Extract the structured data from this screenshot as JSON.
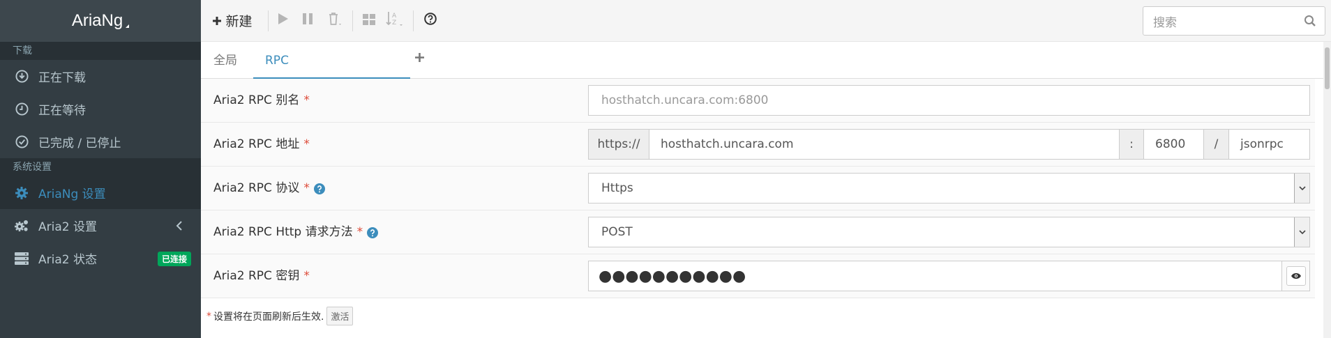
{
  "app": {
    "title": "AriaNg"
  },
  "sidebar": {
    "downloads_header": "下载",
    "downloads": [
      {
        "label": "正在下载",
        "icon": "download-icon"
      },
      {
        "label": "正在等待",
        "icon": "clock-icon"
      },
      {
        "label": "已完成 / 已停止",
        "icon": "check-circle-icon"
      }
    ],
    "settings_header": "系统设置",
    "settings": [
      {
        "label": "AriaNg 设置",
        "icon": "gear-icon",
        "active": true
      },
      {
        "label": "Aria2 设置",
        "icon": "gears-icon"
      },
      {
        "label": "Aria2 状态",
        "icon": "server-icon",
        "badge": "已连接"
      }
    ]
  },
  "toolbar": {
    "new_label": "新建",
    "search_placeholder": "搜索"
  },
  "tabs": {
    "global": "全局",
    "rpc": "RPC"
  },
  "form": {
    "alias": {
      "label": "Aria2 RPC 别名",
      "required": "*",
      "placeholder": "hosthatch.uncara.com:6800"
    },
    "address": {
      "label": "Aria2 RPC 地址",
      "required": "*",
      "protocol_prefix": "https://",
      "host": "hosthatch.uncara.com",
      "colon": ":",
      "port": "6800",
      "slash": "/",
      "path": "jsonrpc"
    },
    "protocol": {
      "label": "Aria2 RPC 协议",
      "required": "*",
      "value": "Https"
    },
    "http_method": {
      "label": "Aria2 RPC Http 请求方法",
      "required": "*",
      "value": "POST"
    },
    "secret": {
      "label": "Aria2 RPC 密钥",
      "required": "*",
      "masked": "●●●●●●●●●●●"
    }
  },
  "footnote": {
    "star": "*",
    "text": "设置将在页面刷新后生效.",
    "activate": "激活"
  },
  "colors": {
    "sidebar_bg": "#333d43",
    "accent": "#3c8dbc",
    "badge_green": "#00a65a",
    "required_red": "#dd4b39"
  }
}
